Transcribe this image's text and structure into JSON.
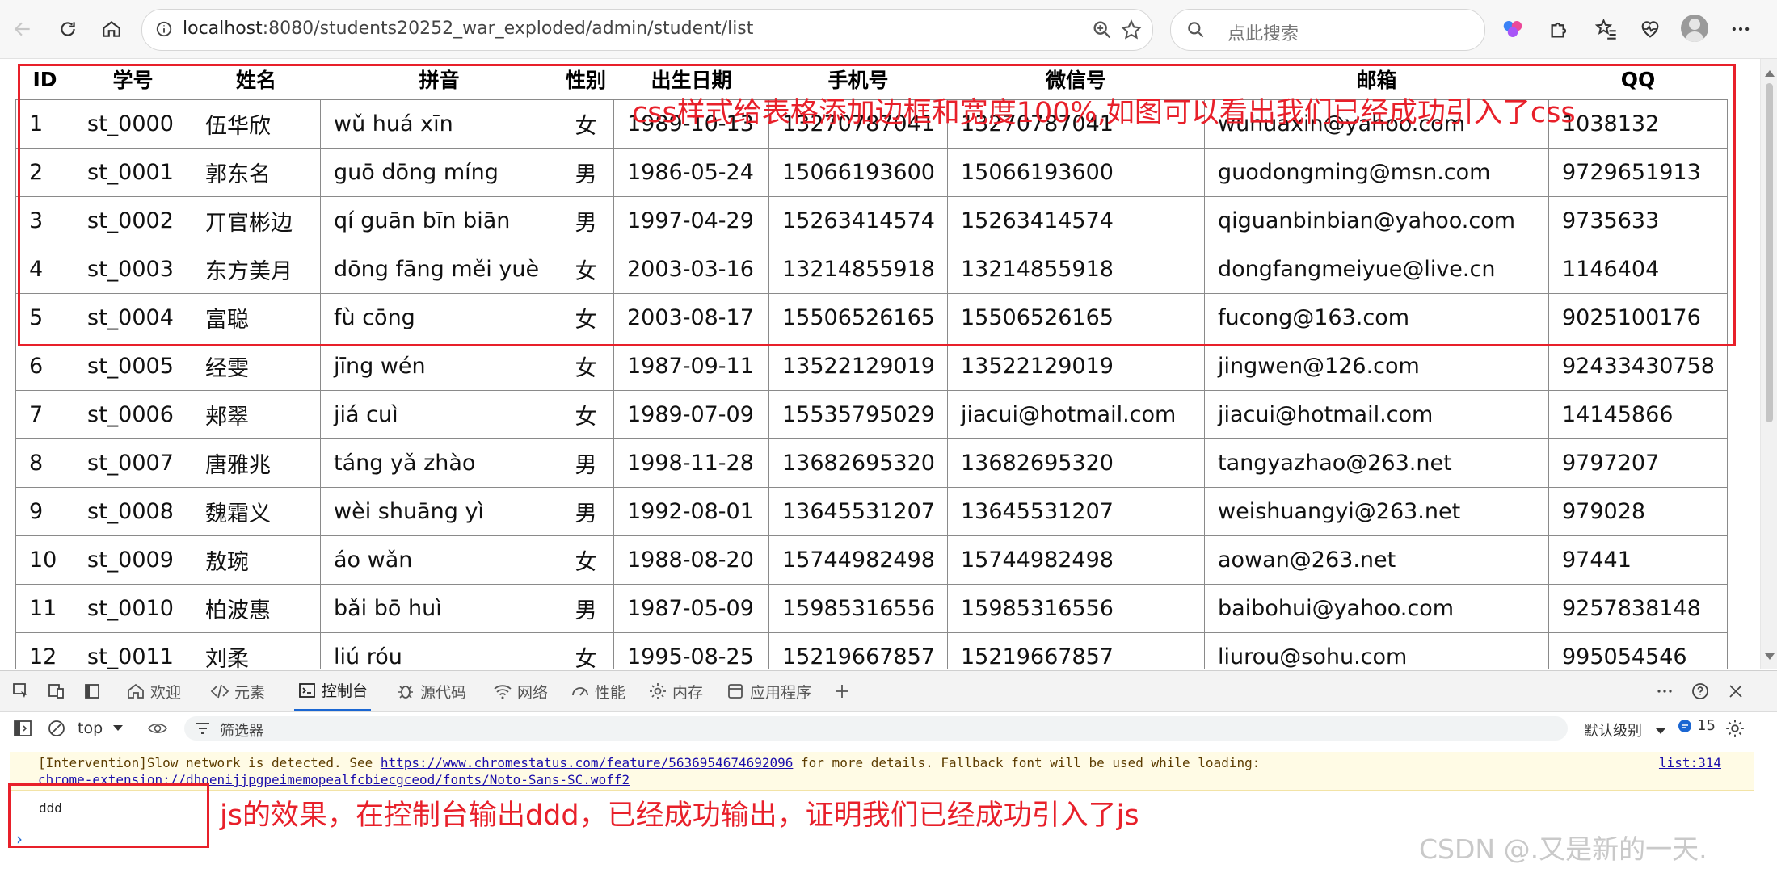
{
  "browser": {
    "url_host": "localhost",
    "url_path": ":8080/students20252_war_exploded/admin/student/list",
    "search_placeholder": "点此搜索"
  },
  "table": {
    "headers": [
      "ID",
      "学号",
      "姓名",
      "拼音",
      "性别",
      "出生日期",
      "手机号",
      "微信号",
      "邮箱",
      "QQ"
    ],
    "rows": [
      [
        "1",
        "st_0000",
        "伍华欣",
        "wǔ huá xīn",
        "女",
        "1989-10-13",
        "13270787041",
        "13270787041",
        "wuhuaxin@yahoo.com",
        "1038132"
      ],
      [
        "2",
        "st_0001",
        "郭东名",
        "guō dōng míng",
        "男",
        "1986-05-24",
        "15066193600",
        "15066193600",
        "guodongming@msn.com",
        "9729651913"
      ],
      [
        "3",
        "st_0002",
        "丌官彬边",
        "qí guān bīn biān",
        "男",
        "1997-04-29",
        "15263414574",
        "15263414574",
        "qiguanbinbian@yahoo.com",
        "9735633"
      ],
      [
        "4",
        "st_0003",
        "东方美月",
        "dōng fāng měi yuè",
        "女",
        "2003-03-16",
        "13214855918",
        "13214855918",
        "dongfangmeiyue@live.cn",
        "1146404"
      ],
      [
        "5",
        "st_0004",
        "富聪",
        "fù cōng",
        "女",
        "2003-08-17",
        "15506526165",
        "15506526165",
        "fucong@163.com",
        "9025100176"
      ],
      [
        "6",
        "st_0005",
        "经雯",
        "jīng wén",
        "女",
        "1987-09-11",
        "13522129019",
        "13522129019",
        "jingwen@126.com",
        "92433430758"
      ],
      [
        "7",
        "st_0006",
        "郏翠",
        "jiá cuì",
        "女",
        "1989-07-09",
        "15535795029",
        "jiacui@hotmail.com",
        "jiacui@hotmail.com",
        "14145866"
      ],
      [
        "8",
        "st_0007",
        "唐雅兆",
        "táng yǎ zhào",
        "男",
        "1998-11-28",
        "13682695320",
        "13682695320",
        "tangyazhao@263.net",
        "9797207"
      ],
      [
        "9",
        "st_0008",
        "魏霜义",
        "wèi shuāng yì",
        "男",
        "1992-08-01",
        "13645531207",
        "13645531207",
        "weishuangyi@263.net",
        "979028"
      ],
      [
        "10",
        "st_0009",
        "敖琬",
        "áo wǎn",
        "女",
        "1988-08-20",
        "15744982498",
        "15744982498",
        "aowan@263.net",
        "97441"
      ],
      [
        "11",
        "st_0010",
        "柏波惠",
        "bǎi bō huì",
        "男",
        "1987-05-09",
        "15985316556",
        "15985316556",
        "baibohui@yahoo.com",
        "9257838148"
      ],
      [
        "12",
        "st_0011",
        "刘柔",
        "liú róu",
        "女",
        "1995-08-25",
        "15219667857",
        "15219667857",
        "liurou@sohu.com",
        "995054546"
      ]
    ]
  },
  "annotations": {
    "css_note": "css样式给表格添加边框和宽度100%,如图可以看出我们已经成功引入了css",
    "js_note": "js的效果，在控制台输出ddd，已经成功输出，证明我们已经成功引入了js"
  },
  "devtools": {
    "tabs": [
      "欢迎",
      "元素",
      "控制台",
      "源代码",
      "网络",
      "性能",
      "内存",
      "应用程序"
    ],
    "active_tab": "控制台",
    "context": "top",
    "filter_placeholder": "筛选器",
    "log_level": "默认级别",
    "issues_count": "15",
    "warning_prefix": "[Intervention]Slow network is detected. See ",
    "warning_link": "https://www.chromestatus.com/feature/5636954674692096",
    "warning_suffix": " for more details. Fallback font will be used while loading:",
    "warning_font_url": "chrome-extension://dhoenijjpgpeimemopealfcbiecgceod/fonts/Noto-Sans-SC.woff2",
    "warning_source": "list:314",
    "log_output": "ddd",
    "prompt": "›"
  },
  "watermark": "CSDN @.又是新的一天."
}
